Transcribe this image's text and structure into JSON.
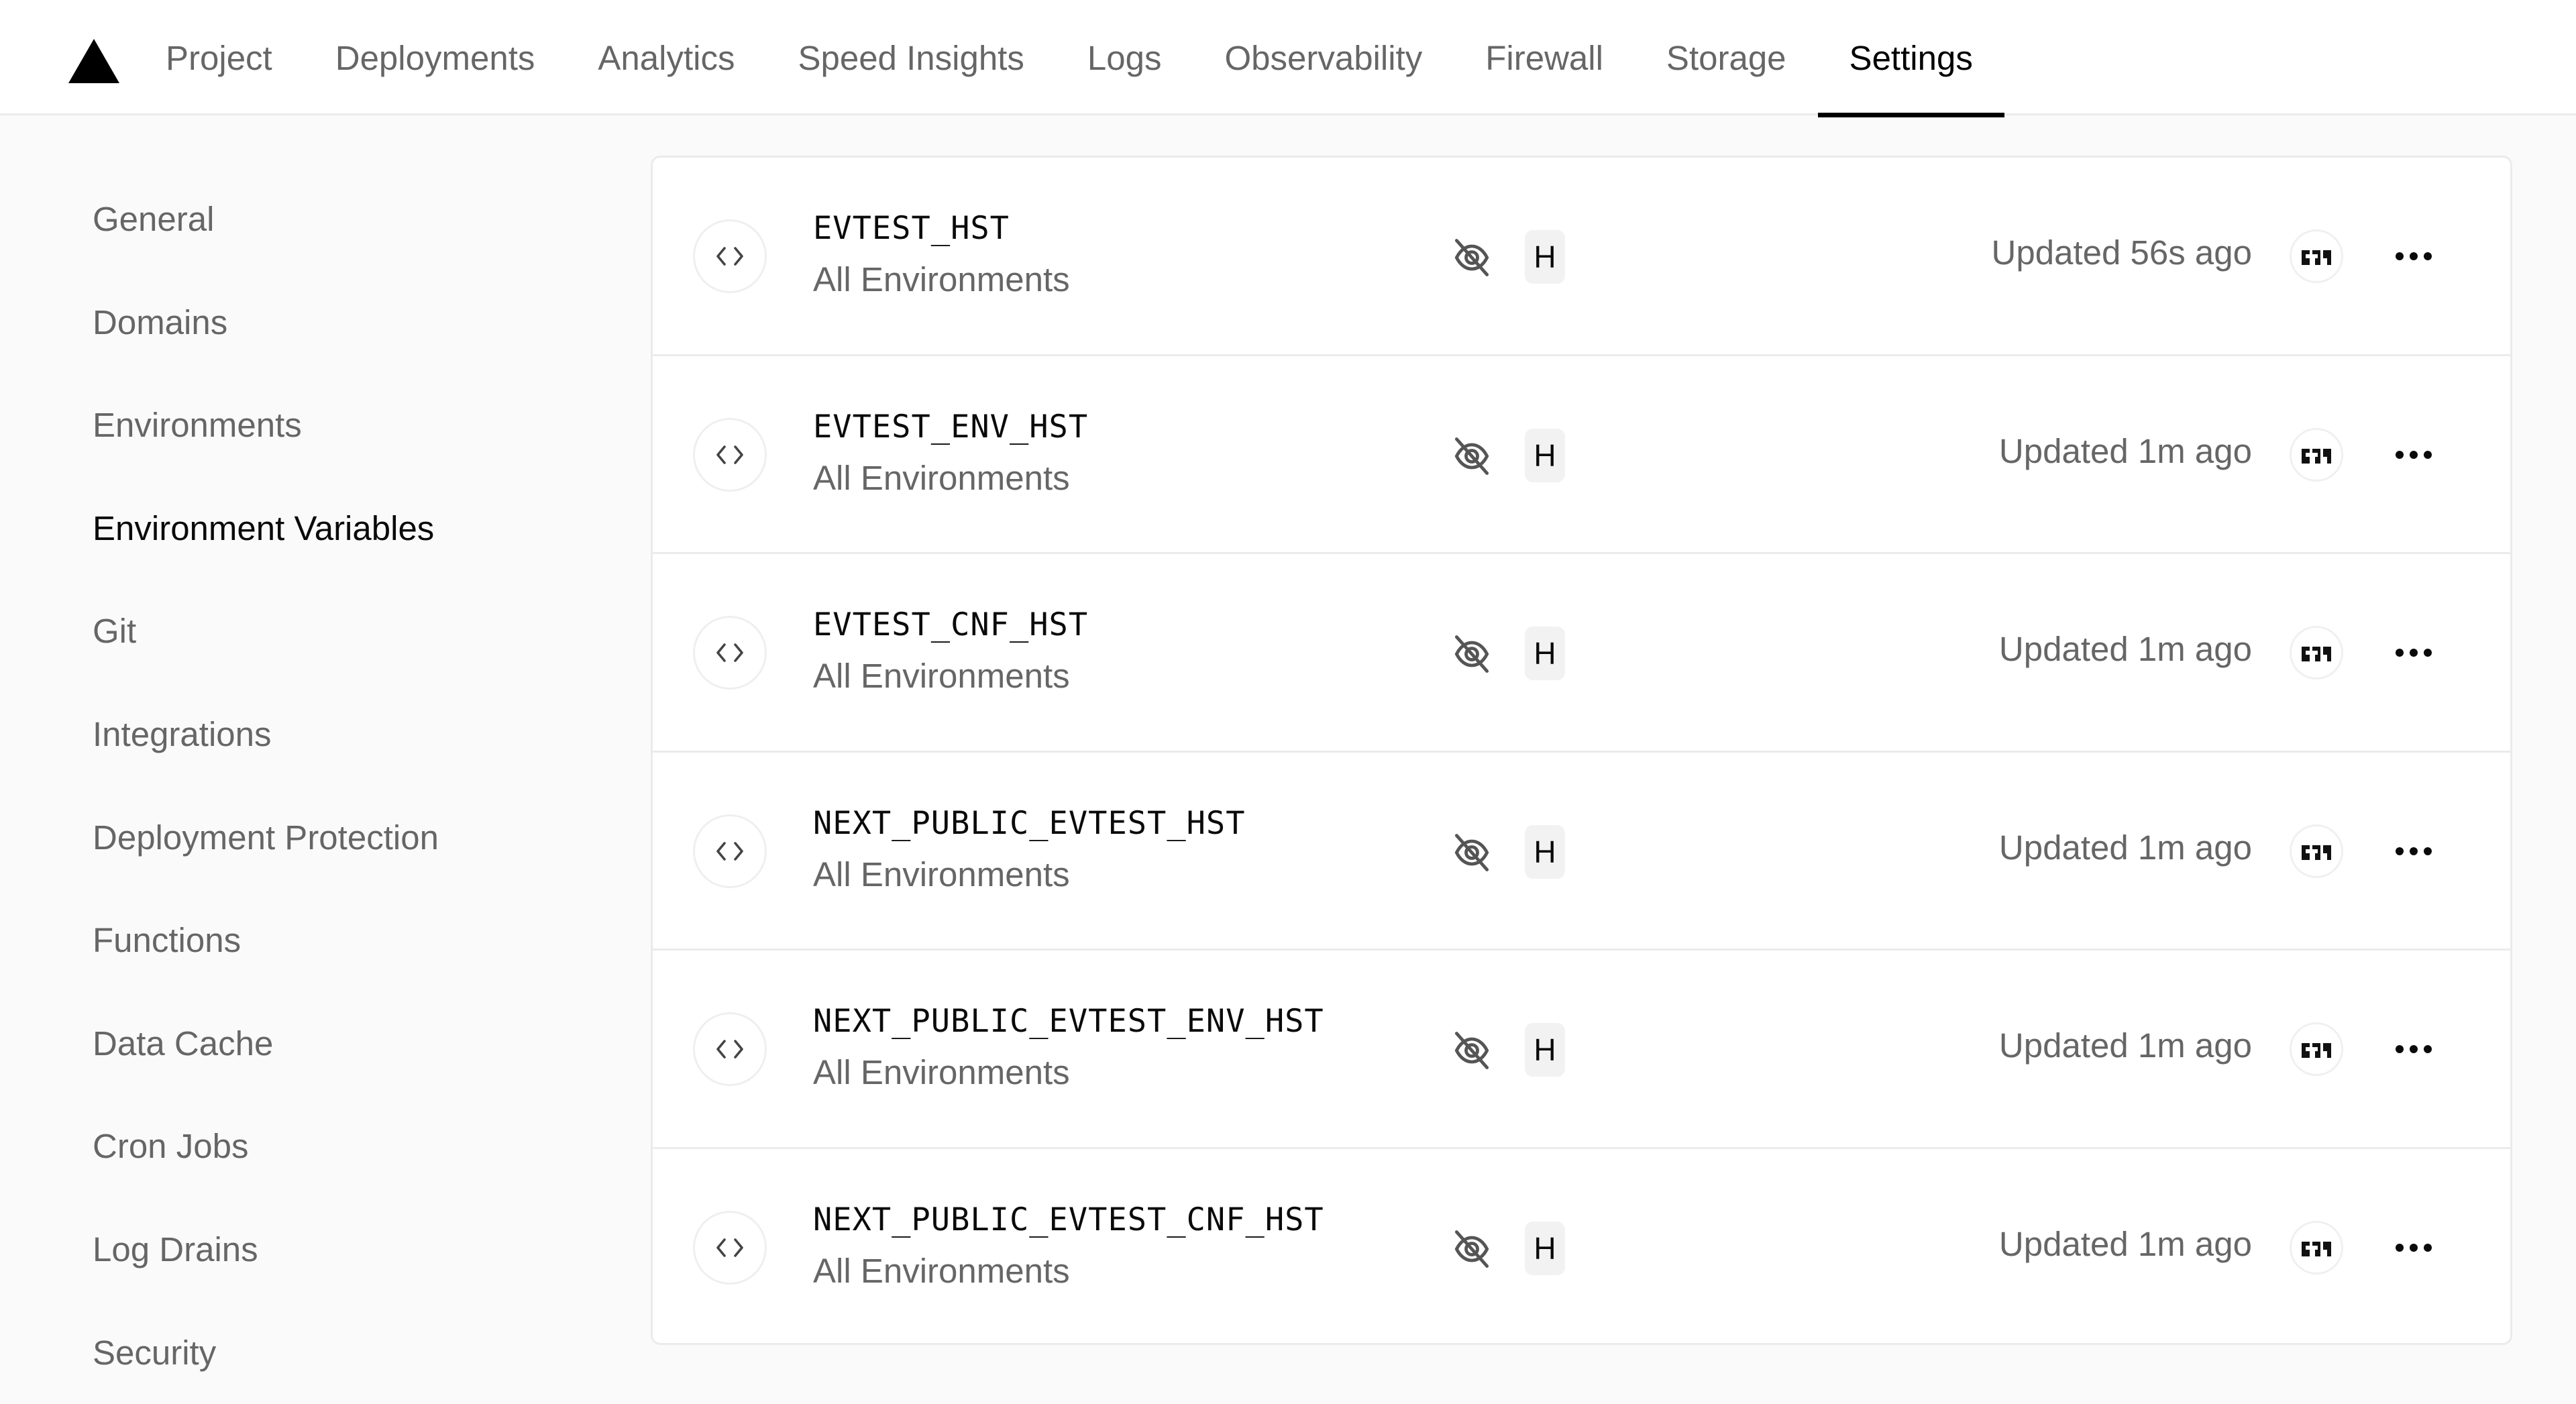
{
  "header": {
    "logo": "triangle-logo",
    "tabs": [
      {
        "label": "Project",
        "active": false
      },
      {
        "label": "Deployments",
        "active": false
      },
      {
        "label": "Analytics",
        "active": false
      },
      {
        "label": "Speed Insights",
        "active": false
      },
      {
        "label": "Logs",
        "active": false
      },
      {
        "label": "Observability",
        "active": false
      },
      {
        "label": "Firewall",
        "active": false
      },
      {
        "label": "Storage",
        "active": false
      },
      {
        "label": "Settings",
        "active": true
      }
    ]
  },
  "sidebar": {
    "items": [
      {
        "label": "General",
        "active": false
      },
      {
        "label": "Domains",
        "active": false
      },
      {
        "label": "Environments",
        "active": false
      },
      {
        "label": "Environment Variables",
        "active": true
      },
      {
        "label": "Git",
        "active": false
      },
      {
        "label": "Integrations",
        "active": false
      },
      {
        "label": "Deployment Protection",
        "active": false
      },
      {
        "label": "Functions",
        "active": false
      },
      {
        "label": "Data Cache",
        "active": false
      },
      {
        "label": "Cron Jobs",
        "active": false
      },
      {
        "label": "Log Drains",
        "active": false
      },
      {
        "label": "Security",
        "active": false
      }
    ]
  },
  "env_vars": [
    {
      "name": "EVTEST_HST",
      "environment": "All Environments",
      "badge": "H",
      "updated": "Updated 56s ago",
      "icons": {
        "type": "code-icon",
        "visibility": "eye-off-icon",
        "avatar": "user-avatar",
        "menu": "more-horizontal-icon"
      }
    },
    {
      "name": "EVTEST_ENV_HST",
      "environment": "All Environments",
      "badge": "H",
      "updated": "Updated 1m ago",
      "icons": {
        "type": "code-icon",
        "visibility": "eye-off-icon",
        "avatar": "user-avatar",
        "menu": "more-horizontal-icon"
      }
    },
    {
      "name": "EVTEST_CNF_HST",
      "environment": "All Environments",
      "badge": "H",
      "updated": "Updated 1m ago",
      "icons": {
        "type": "code-icon",
        "visibility": "eye-off-icon",
        "avatar": "user-avatar",
        "menu": "more-horizontal-icon"
      }
    },
    {
      "name": "NEXT_PUBLIC_EVTEST_HST",
      "environment": "All Environments",
      "badge": "H",
      "updated": "Updated 1m ago",
      "icons": {
        "type": "code-icon",
        "visibility": "eye-off-icon",
        "avatar": "user-avatar",
        "menu": "more-horizontal-icon"
      }
    },
    {
      "name": "NEXT_PUBLIC_EVTEST_ENV_HST",
      "environment": "All Environments",
      "badge": "H",
      "updated": "Updated 1m ago",
      "icons": {
        "type": "code-icon",
        "visibility": "eye-off-icon",
        "avatar": "user-avatar",
        "menu": "more-horizontal-icon"
      }
    },
    {
      "name": "NEXT_PUBLIC_EVTEST_CNF_HST",
      "environment": "All Environments",
      "badge": "H",
      "updated": "Updated 1m ago",
      "icons": {
        "type": "code-icon",
        "visibility": "eye-off-icon",
        "avatar": "user-avatar",
        "menu": "more-horizontal-icon"
      }
    }
  ]
}
